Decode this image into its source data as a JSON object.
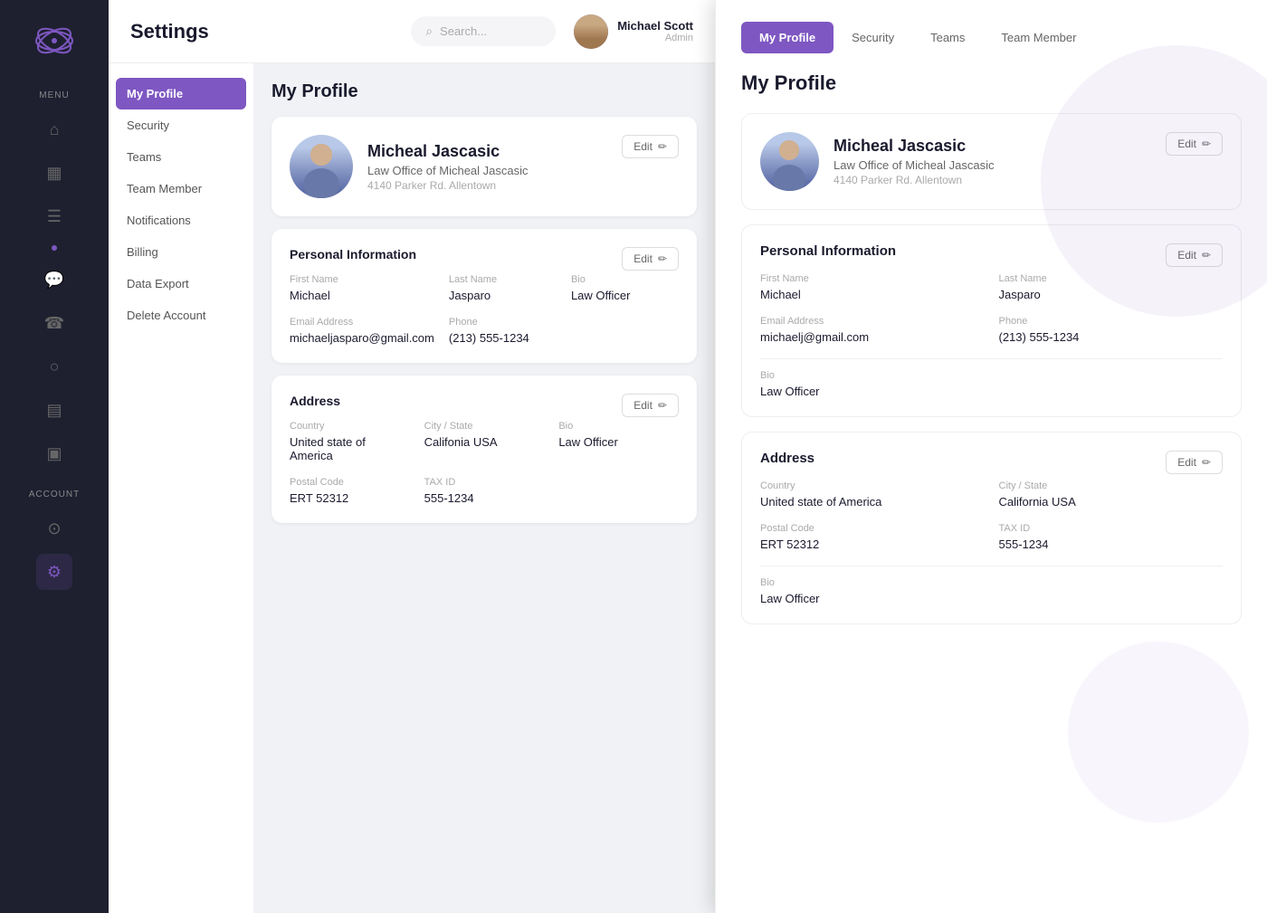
{
  "app": {
    "title": "Settings",
    "search_placeholder": "Search..."
  },
  "user": {
    "name": "Michael Scott",
    "role": "Admin"
  },
  "sidebar": {
    "menu_label": "MENU",
    "account_label": "ACCOUNT",
    "icons": [
      "🏠",
      "📅",
      "📋",
      "💬",
      "📞",
      "⏰",
      "📊",
      "📁"
    ]
  },
  "left_nav": {
    "items": [
      {
        "label": "My Profile",
        "active": true
      },
      {
        "label": "Security",
        "active": false
      },
      {
        "label": "Teams",
        "active": false
      },
      {
        "label": "Team Member",
        "active": false
      },
      {
        "label": "Notifications",
        "active": false
      },
      {
        "label": "Billing",
        "active": false
      },
      {
        "label": "Data Export",
        "active": false
      },
      {
        "label": "Delete Account",
        "active": false
      }
    ]
  },
  "page_title": "My Profile",
  "profile_card": {
    "name": "Micheal Jascasic",
    "org": "Law Office of Micheal Jascasic",
    "address": "4140 Parker Rd. Allentown",
    "edit_btn": "Edit"
  },
  "personal_info": {
    "section_title": "Personal Information",
    "edit_btn": "Edit",
    "first_name_label": "First Name",
    "first_name": "Michael",
    "last_name_label": "Last Name",
    "last_name": "Jasparo",
    "bio_label": "Bio",
    "bio": "Law Officer",
    "email_label": "Email Address",
    "email": "michaeljasparo@gmail.com",
    "phone_label": "Phone",
    "phone": "(213) 555-1234"
  },
  "address_card": {
    "section_title": "Address",
    "edit_btn": "Edit",
    "country_label": "Country",
    "country": "United state of America",
    "city_label": "City / State",
    "city": "Califonia USA",
    "bio_label": "Bio",
    "bio": "Law Officer",
    "postal_label": "Postal Code",
    "postal": "ERT 52312",
    "tax_label": "TAX ID",
    "tax": "555-1234"
  },
  "right_panel": {
    "tabs": [
      {
        "label": "My Profile",
        "active": true
      },
      {
        "label": "Security",
        "active": false
      },
      {
        "label": "Teams",
        "active": false
      },
      {
        "label": "Team Member",
        "active": false
      }
    ],
    "page_title": "My Profile",
    "profile": {
      "name": "Micheal Jascasic",
      "org": "Law Office of Micheal Jascasic",
      "address": "4140 Parker Rd. Allentown",
      "edit_btn": "Edit"
    },
    "personal_info": {
      "section_title": "Personal Information",
      "edit_btn": "Edit",
      "first_name_label": "First Name",
      "first_name": "Michael",
      "last_name_label": "Last Name",
      "last_name": "Jasparo",
      "email_label": "Email Address",
      "email": "michaelj@gmail.com",
      "phone_label": "Phone",
      "phone": "(213) 555-1234",
      "bio_label": "Bio",
      "bio": "Law Officer"
    },
    "address": {
      "section_title": "Address",
      "edit_btn": "Edit",
      "country_label": "Country",
      "country": "United state of America",
      "city_label": "City / State",
      "city": "California USA",
      "postal_label": "Postal Code",
      "postal": "ERT 52312",
      "tax_label": "TAX ID",
      "tax": "555-1234",
      "bio_label": "Bio",
      "bio": "Law Officer"
    }
  }
}
